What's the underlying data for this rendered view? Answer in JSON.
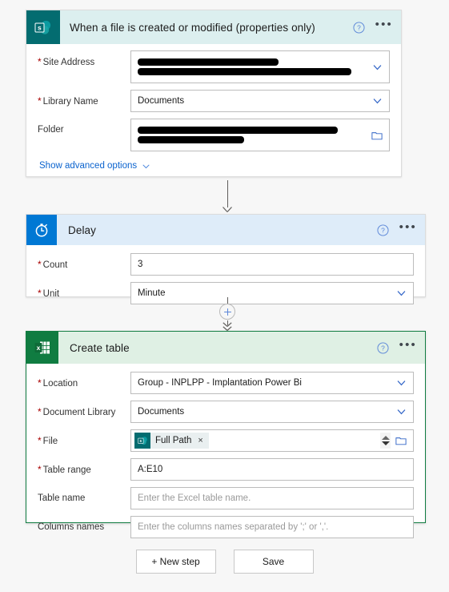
{
  "steps": [
    {
      "id": "trigger",
      "title": "When a file is created or modified (properties only)",
      "icon": "sharepoint-icon",
      "header_bg": "#dcefef",
      "icon_bg": "#036c70",
      "help_label": "?",
      "menu_label": "•••",
      "fields": [
        {
          "label": "Site Address",
          "required": true,
          "kind": "redacted-dropdown",
          "redactions": [
            62,
            94
          ]
        },
        {
          "label": "Library Name",
          "required": true,
          "kind": "dropdown",
          "value": "Documents"
        },
        {
          "label": "Folder",
          "required": false,
          "kind": "redacted-folder",
          "redactions": [
            88,
            47
          ]
        }
      ],
      "advanced_link": "Show advanced options"
    },
    {
      "id": "delay",
      "title": "Delay",
      "icon": "stopwatch-icon",
      "header_bg": "#deecf9",
      "icon_bg": "#0078d4",
      "help_label": "?",
      "menu_label": "•••",
      "fields": [
        {
          "label": "Count",
          "required": true,
          "kind": "text",
          "value": "3"
        },
        {
          "label": "Unit",
          "required": true,
          "kind": "dropdown",
          "value": "Minute"
        }
      ]
    },
    {
      "id": "create-table",
      "title": "Create table",
      "icon": "excel-icon",
      "header_bg": "#dff0e4",
      "icon_bg": "#107c41",
      "selected": true,
      "help_label": "?",
      "menu_label": "•••",
      "fields": [
        {
          "label": "Location",
          "required": true,
          "kind": "dropdown",
          "value": "Group - INPLPP - Implantation Power Bi"
        },
        {
          "label": "Document Library",
          "required": true,
          "kind": "dropdown",
          "value": "Documents"
        },
        {
          "label": "File",
          "required": true,
          "kind": "token",
          "token": "Full Path",
          "token_icon": "sharepoint-icon",
          "token_remove": "×"
        },
        {
          "label": "Table range",
          "required": true,
          "kind": "text",
          "value": "A:E10"
        },
        {
          "label": "Table name",
          "required": false,
          "kind": "text",
          "value": "",
          "placeholder": "Enter the Excel table name."
        },
        {
          "label": "Columns names",
          "required": false,
          "kind": "text",
          "value": "",
          "placeholder": "Enter the columns names separated by ';' or ','."
        }
      ]
    }
  ],
  "footer": {
    "new_step_label": "+ New step",
    "save_label": "Save"
  },
  "colors": {
    "accent_blue": "#0078d4",
    "link_blue": "#0b63ce",
    "required_red": "#a80000",
    "sharepoint_teal": "#036c70",
    "excel_green": "#107c41"
  }
}
